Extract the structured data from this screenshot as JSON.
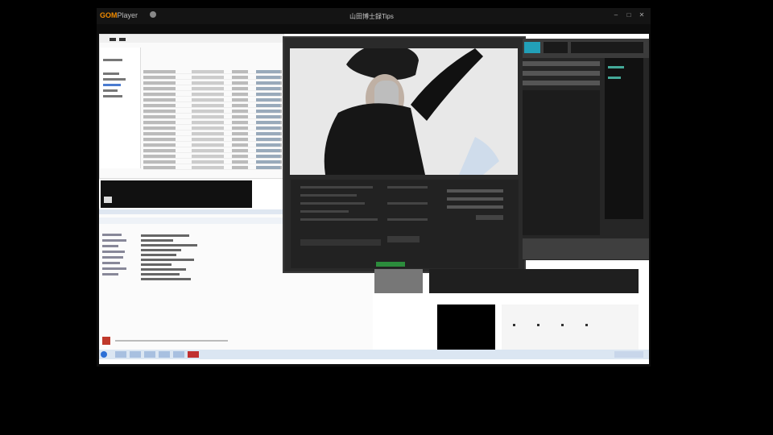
{
  "player": {
    "brand": "GOM",
    "brand_suffix": "Player",
    "title": "山田博士録Tips"
  },
  "taskbar": {
    "time": ""
  },
  "colors": {
    "brand": "#f08a00",
    "accent_green": "#2c8c3c",
    "blue": "#2b6fd6"
  }
}
